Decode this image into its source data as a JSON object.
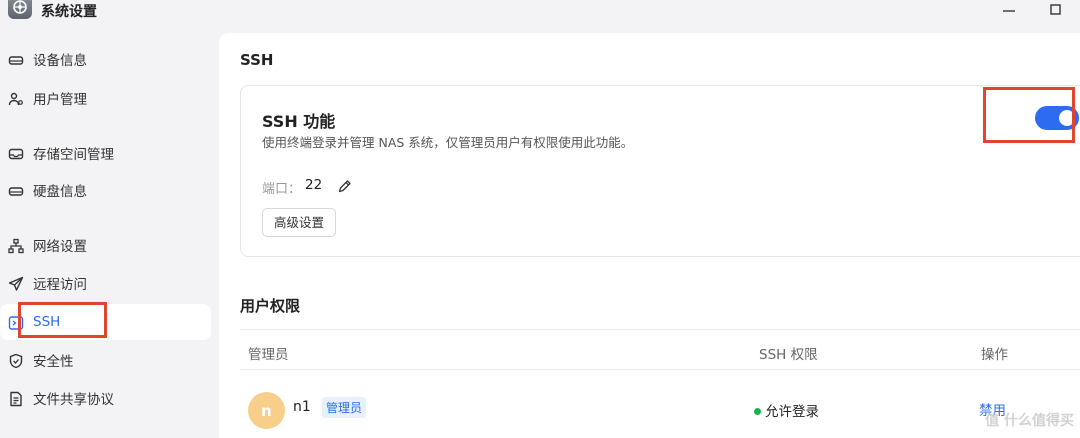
{
  "window": {
    "title": "系统设置"
  },
  "sidebar": {
    "items": [
      {
        "label": "设备信息",
        "icon": "device-icon",
        "active": false
      },
      {
        "label": "用户管理",
        "icon": "user-icon",
        "active": false
      },
      {
        "label": "存储空间管理",
        "icon": "storage-icon",
        "active": false
      },
      {
        "label": "硬盘信息",
        "icon": "disk-icon",
        "active": false
      },
      {
        "label": "网络设置",
        "icon": "network-icon",
        "active": false
      },
      {
        "label": "远程访问",
        "icon": "send-icon",
        "active": false
      },
      {
        "label": "SSH",
        "icon": "ssh-icon",
        "active": true
      },
      {
        "label": "安全性",
        "icon": "shield-icon",
        "active": false
      },
      {
        "label": "文件共享协议",
        "icon": "file-icon",
        "active": false
      }
    ]
  },
  "main": {
    "section_title": "SSH",
    "ssh_card": {
      "title": "SSH 功能",
      "description": "使用终端登录并管理 NAS 系统，仅管理员用户有权限使用此功能。",
      "port_label": "端口：",
      "port_value": "22",
      "advanced_button": "高级设置",
      "enabled": true
    },
    "permissions": {
      "title": "用户权限",
      "columns": [
        "管理员",
        "SSH 权限",
        "操作"
      ],
      "rows": [
        {
          "avatar": "n",
          "name": "n1",
          "role_badge": "管理员",
          "status": "允许登录",
          "action": "禁用"
        }
      ]
    }
  },
  "watermark": "值 什么值得买",
  "colors": {
    "accent": "#2d6bf0",
    "highlight": "#e2452e",
    "status_green": "#19b34a",
    "avatar": "#f7cf8a"
  }
}
